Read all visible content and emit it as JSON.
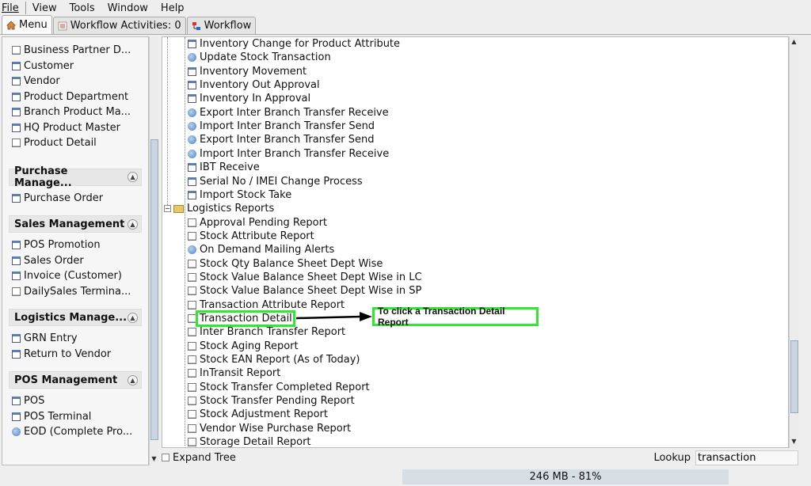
{
  "menu": [
    "File",
    "View",
    "Tools",
    "Window",
    "Help"
  ],
  "tabs": {
    "menu": "Menu",
    "workflow_activities": "Workflow Activities: 0",
    "workflow": "Workflow"
  },
  "sidebar": {
    "top_items": [
      "Business Partner D...",
      "Customer",
      "Vendor",
      "Product Department",
      "Branch Product Ma...",
      "HQ Product Master",
      "Product Detail"
    ],
    "groups": [
      {
        "title": "Purchase Manage...",
        "items": [
          "Purchase Order"
        ]
      },
      {
        "title": "Sales Management",
        "items": [
          "POS Promotion",
          "Sales Order",
          "Invoice (Customer)",
          "DailySales Termina..."
        ]
      },
      {
        "title": "Logistics Manage...",
        "items": [
          "GRN Entry",
          "Return to Vendor"
        ]
      },
      {
        "title": "POS Management",
        "items": [
          "POS",
          "POS Terminal",
          "EOD (Complete Pro..."
        ]
      }
    ]
  },
  "tree": {
    "process_items": [
      {
        "label": "Inventory Change for Product Attribute",
        "icon": "window-icon"
      },
      {
        "label": "Update Stock Transaction",
        "icon": "process-icon"
      },
      {
        "label": "Inventory Movement",
        "icon": "window-icon"
      },
      {
        "label": "Inventory Out Approval",
        "icon": "window-icon"
      },
      {
        "label": "Inventory In Approval",
        "icon": "window-icon"
      },
      {
        "label": "Export Inter Branch Transfer Receive",
        "icon": "process-icon"
      },
      {
        "label": "Import Inter Branch Transfer Send",
        "icon": "process-icon"
      },
      {
        "label": "Export Inter Branch Transfer Send",
        "icon": "process-icon"
      },
      {
        "label": "Import Inter Branch Transfer Receive",
        "icon": "process-icon"
      },
      {
        "label": "IBT Receive",
        "icon": "window-icon"
      },
      {
        "label": "Serial No / IMEI Change Process",
        "icon": "window-icon"
      },
      {
        "label": "Import Stock Take",
        "icon": "window-icon"
      }
    ],
    "folder": "Logistics Reports",
    "report_items": [
      {
        "label": "Approval Pending Report",
        "icon": "report-icon"
      },
      {
        "label": "Stock Attribute Report",
        "icon": "report-icon"
      },
      {
        "label": "On Demand Mailing Alerts",
        "icon": "process-icon"
      },
      {
        "label": "Stock Qty Balance Sheet Dept Wise",
        "icon": "report-icon"
      },
      {
        "label": "Stock Value Balance Sheet Dept Wise in LC",
        "icon": "report-icon"
      },
      {
        "label": "Stock Value Balance Sheet Dept Wise in SP",
        "icon": "report-icon"
      },
      {
        "label": "Transaction Attribute Report",
        "icon": "report-icon"
      },
      {
        "label": "Transaction Detail",
        "icon": "report-icon"
      },
      {
        "label": "Inter Branch Transfer Report",
        "icon": "report-icon"
      },
      {
        "label": "Stock Aging Report",
        "icon": "report-icon"
      },
      {
        "label": "Stock EAN Report (As of Today)",
        "icon": "report-icon"
      },
      {
        "label": "InTransit Report",
        "icon": "report-icon"
      },
      {
        "label": "Stock Transfer Completed Report",
        "icon": "report-icon"
      },
      {
        "label": "Stock Transfer Pending Report",
        "icon": "report-icon"
      },
      {
        "label": "Stock Adjustment Report",
        "icon": "report-icon"
      },
      {
        "label": "Vendor Wise Purchase Report",
        "icon": "report-icon"
      },
      {
        "label": "Storage Detail Report",
        "icon": "report-icon"
      }
    ]
  },
  "bottom": {
    "expand_tree": "Expand Tree",
    "lookup_label": "Lookup",
    "lookup_value": "transaction"
  },
  "status": {
    "memory": "246 MB - 81%"
  },
  "annotation": {
    "callout": "To click a Transaction Detail Report"
  },
  "colors": {
    "highlight": "#33e633",
    "selection_bg": "#d5dde5"
  }
}
